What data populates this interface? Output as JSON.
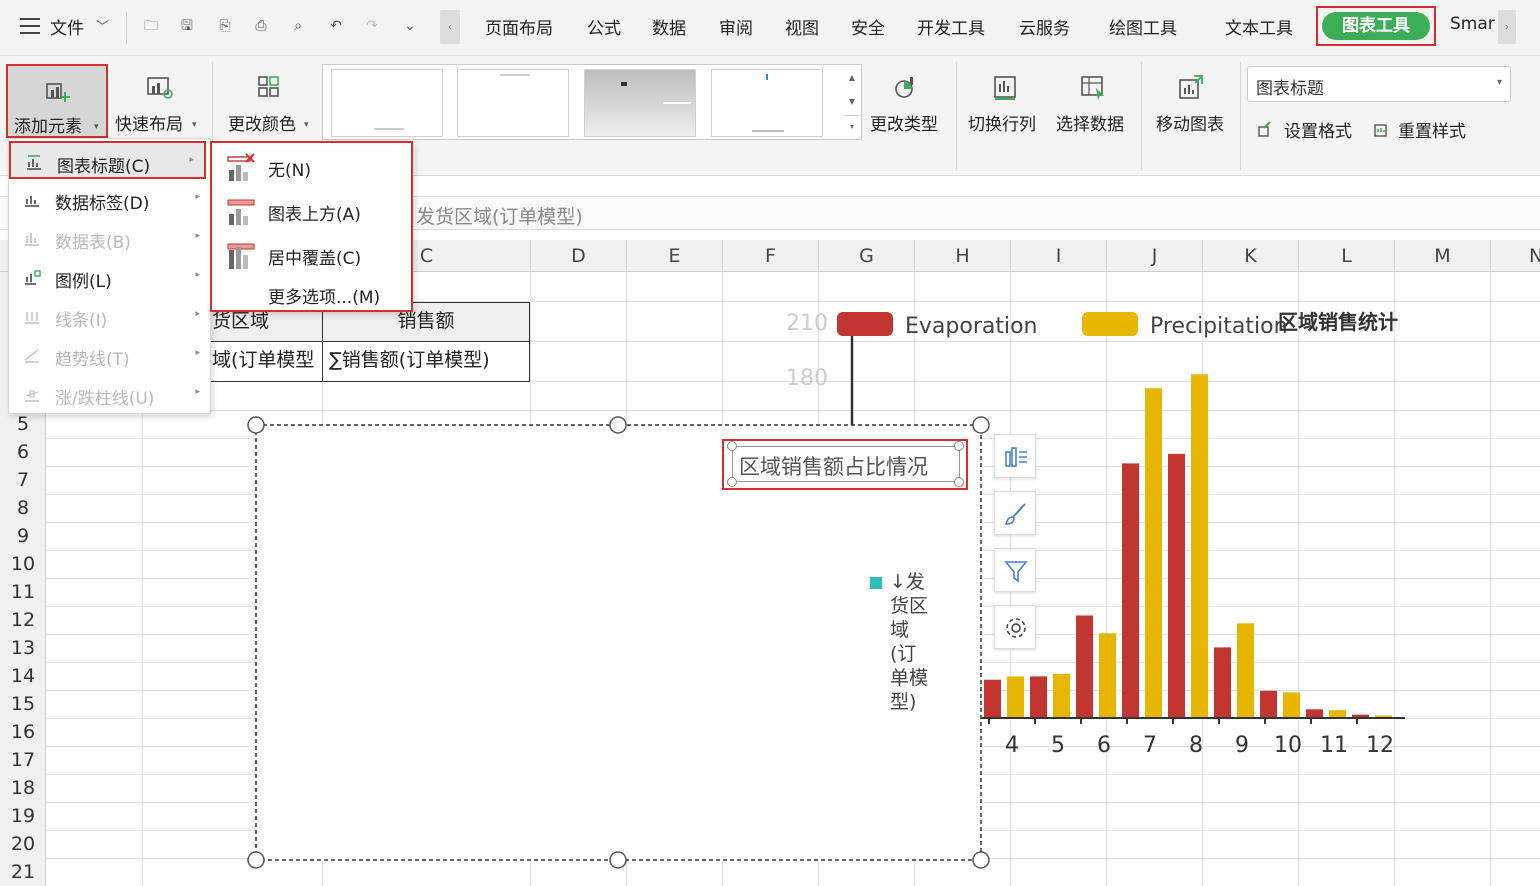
{
  "menubar": {
    "file": "文件",
    "tabs": [
      "页面布局",
      "公式",
      "数据",
      "审阅",
      "视图",
      "安全",
      "开发工具",
      "云服务",
      "绘图工具",
      "文本工具",
      "图表工具",
      "Smar"
    ]
  },
  "ribbon": {
    "add_element": "添加元素",
    "quick_layout": "快速布局",
    "change_color": "更改颜色",
    "change_type": "更改类型",
    "switch_row_col": "切换行列",
    "select_data": "选择数据",
    "move_chart": "移动图表",
    "element_select_value": "图表标题",
    "set_format": "设置格式",
    "reset_style": "重置样式"
  },
  "add_element_menu": {
    "items": [
      {
        "label": "图表标题(C)",
        "enabled": true
      },
      {
        "label": "数据标签(D)",
        "enabled": true
      },
      {
        "label": "数据表(B)",
        "enabled": false
      },
      {
        "label": "图例(L)",
        "enabled": true
      },
      {
        "label": "线条(I)",
        "enabled": false
      },
      {
        "label": "趋势线(T)",
        "enabled": false
      },
      {
        "label": "涨/跌柱线(U)",
        "enabled": false
      }
    ]
  },
  "title_submenu": {
    "items": [
      "无(N)",
      "图表上方(A)",
      "居中覆盖(C)",
      "更多选项...(M)"
    ]
  },
  "formula_bar": {
    "text": "发货区域(订单模型)"
  },
  "sheet": {
    "columns": [
      "C",
      "D",
      "E",
      "F",
      "G",
      "H",
      "I",
      "J",
      "K",
      "L",
      "M",
      "N"
    ],
    "rows": [
      "5",
      "6",
      "7",
      "8",
      "9",
      "10",
      "11",
      "12",
      "13",
      "14",
      "15",
      "16",
      "17",
      "18",
      "19",
      "20",
      "21"
    ],
    "pivot": {
      "header_a": "货区域",
      "header_b": "销售额",
      "row_a": "域(订单模型",
      "row_b": "∑销售额(订单模型)"
    }
  },
  "selected_chart": {
    "title": "区域销售额占比情况",
    "legend_text": "↓发货区域(订单模型)",
    "legend_color": "#2bbdbd"
  },
  "bg_chart": {
    "title": "区域销售统计",
    "legend": [
      "Evaporation",
      "Precipitation"
    ],
    "y_ticks": [
      "210",
      "180"
    ],
    "colors": {
      "evaporation": "#c23531",
      "precipitation": "#e6b600"
    }
  },
  "chart_data": {
    "type": "bar",
    "title": "区域销售统计",
    "categories": [
      "4",
      "5",
      "6",
      "7",
      "8",
      "9",
      "10",
      "11",
      "12"
    ],
    "series": [
      {
        "name": "Evaporation",
        "values": [
          26.4,
          28.7,
          70.7,
          175.6,
          182.2,
          48.7,
          18.8,
          6.0,
          2.3
        ]
      },
      {
        "name": "Precipitation",
        "values": [
          28.7,
          30.4,
          58.4,
          227.4,
          237.0,
          65.3,
          17.6,
          5.4,
          1.7
        ]
      }
    ],
    "y_ticks": [
      "210",
      "180"
    ]
  }
}
